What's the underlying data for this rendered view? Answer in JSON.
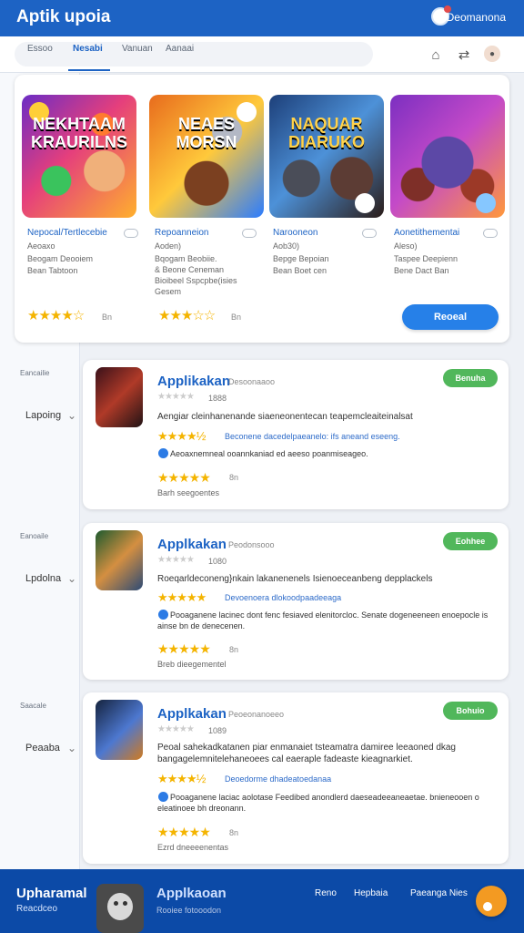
{
  "header": {
    "title": "Aptik upoia",
    "user_name": "Deomanona",
    "tabs": [
      "Essoo",
      "Nesabi",
      "Vanuan",
      "Aanaai"
    ],
    "tool_icons": [
      "home-icon",
      "share-icon",
      "profile-icon"
    ]
  },
  "featured": {
    "games": [
      {
        "title": "NEKHTAAM KRAURILNS",
        "name": "Nepocal/Tertlecebie",
        "price": "Aeoaxo",
        "meta": [
          "Beogam Deooiem",
          "Bean Tabtoon"
        ],
        "rating": "4.5",
        "rating_text": "Bn"
      },
      {
        "title": "NEAES MORSN",
        "name": "Repoanneion",
        "price": "Aoden)",
        "meta": [
          "Bqogam Beobiie.",
          "& Beone Ceneman",
          "Bioibeel Sspcpbe(isies",
          "Gesem"
        ],
        "rating": "3.5",
        "rating_text": "Bn"
      },
      {
        "title": "NAQUAR DIARUKO",
        "name": "Narooneon",
        "price": "Aob30)",
        "meta": [
          "Bepge Bepoian",
          "Bean Boet cen"
        ],
        "rating": "",
        "rating_text": ""
      },
      {
        "title": "",
        "name": "Aonetithementai",
        "price": "Aleso)",
        "meta": [
          "Taspee Deepienn",
          "Bene Dact Ban"
        ],
        "rating": "",
        "rating_text": ""
      }
    ],
    "download_label": "Reoeal"
  },
  "sidebar": [
    {
      "heading": "Eancailie",
      "label": "Lapoing"
    },
    {
      "heading": "Eanoaile",
      "label": "Lpdolna"
    },
    {
      "heading": "Saacale",
      "label": "Peaaba"
    }
  ],
  "apps": [
    {
      "name": "Applikakan",
      "subtitle": "Desoonaaoo",
      "small_rating": "1888",
      "button": "Benuha",
      "desc": "Aengiar cleinhanenande siaeneonentecan teapemcleaiteinalsat",
      "desc_blue": "Beconene dacedelpaeanelo: ifs aneand eseeng.",
      "bullet": "Aeoaxnemneal ooannkaniad ed aeeso poanmiseageo.",
      "rating": "8n",
      "meta": "Barh seegoentes"
    },
    {
      "name": "Applkakan",
      "subtitle": "Peodonsooo",
      "small_rating": "1080",
      "button": "Eohhee",
      "desc": "Roeqarldeconeng}nkain lakanenenels Isienoeceanbeng depplackels",
      "desc_blue": "Devoenoera dlokoodpaadeeaga",
      "bullet": "Pooaganene lacinec dont fenc fesiaved elenitorcloc. Senate dogeneeneen enoepocle is ainse bn de denecenen.",
      "rating": "8n",
      "meta": "Breb dieegementel"
    },
    {
      "name": "Applkakan",
      "subtitle": "Peoeonanoeeo",
      "small_rating": "1089",
      "button": "Bohuio",
      "desc": "Peoal sahekadkatanen piar enmanaiet tsteamatra damiree leeaoned dkag bangagelemnitelehaneoees cal eaeraple fadeaste kieagnarkiet.",
      "desc_blue": "Deoedorme dhadeatoedanaa",
      "bullet": "Pooaganene laciac aolotase Feedibed anondlerd daeseadeeaneaetae. bnieneooen o eleatinoee bh dreonann.",
      "rating": "8n",
      "meta": "Ezrd dneeeenentas"
    }
  ],
  "bottom": {
    "title": "Upharamal",
    "subtitle": "Reacdceo",
    "app_name": "Applkaoan",
    "app_meta": "Rooiee fotooodon",
    "links": [
      "Reno",
      "Hepbaia",
      "Paeanga Nies"
    ]
  }
}
